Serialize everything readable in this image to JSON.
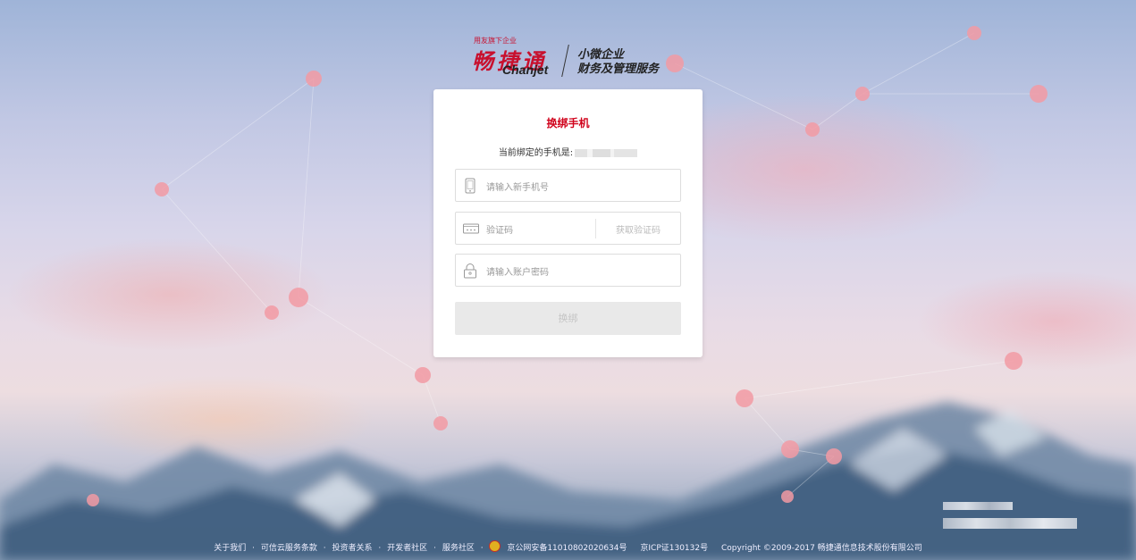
{
  "logo": {
    "tagline": "用友旗下企业",
    "name_cn": "畅捷通",
    "name_en": "Chanjet",
    "slogan_line1": "小微企业",
    "slogan_line2": "财务及管理服务",
    "brand_color": "#c8102e"
  },
  "form": {
    "title": "换绑手机",
    "current_phone_label": "当前绑定的手机是:",
    "new_phone_placeholder": "请输入新手机号",
    "code_placeholder": "验证码",
    "get_code_label": "获取验证码",
    "password_placeholder": "请输入账户密码",
    "submit_label": "换绑",
    "icons": [
      "phone-icon",
      "keyboard-icon",
      "lock-icon"
    ]
  },
  "footer": {
    "about": "关于我们",
    "terms": "可信云服务条款",
    "investors": "投资者关系",
    "developers": "开发者社区",
    "service": "服务社区",
    "sep": "·",
    "police_record": "京公网安备11010802020634号",
    "icp": "京ICP证130132号",
    "copyright": "Copyright ©2009-2017 畅捷通信息技术股份有限公司"
  }
}
